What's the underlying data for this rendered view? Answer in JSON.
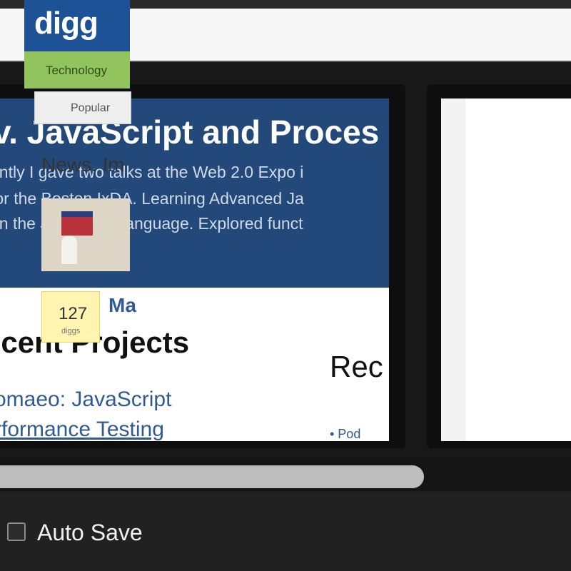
{
  "thumbnail_1": {
    "title": "v. JavaScript and Proces",
    "lines": [
      "ently I gave two talks at the Web 2.0 Expo i",
      "for the Boston IxDA. Learning Advanced Ja",
      "on the JavaScript language. Explored funct"
    ],
    "recent_heading": "ecent Projects",
    "right_heading": "Rec",
    "links": [
      "omaeo: JavaScript",
      "rformance Testing"
    ],
    "tiny_link": "• Pod"
  },
  "thumbnail_2": {
    "logo": "digg",
    "category_label": "Technology",
    "tab_label": "Popular",
    "news_label": "News, Im",
    "digg_count": "127",
    "digg_sub": "diggs",
    "link_text": "Ma"
  },
  "bottom_bar": {
    "autosave_label": "Auto Save"
  },
  "colors": {
    "header_blue": "#23497a",
    "digg_blue": "#1d5396",
    "digg_green": "#91c45d"
  }
}
